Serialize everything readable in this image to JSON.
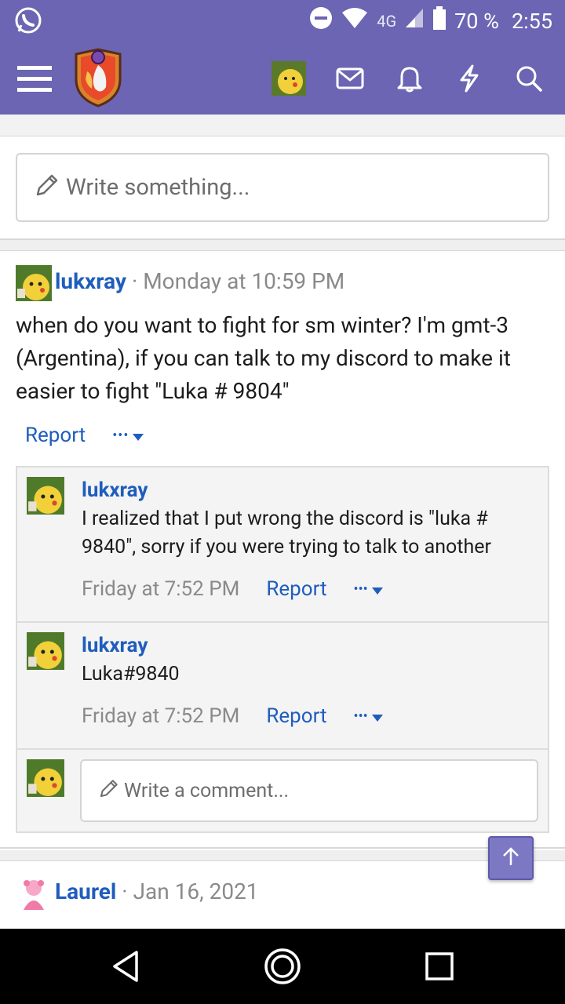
{
  "status_bar": {
    "network": "4G",
    "battery": "70 %",
    "time": "2:55"
  },
  "app_bar": {
    "icons": [
      "menu-icon",
      "site-logo",
      "user-avatar",
      "mail-icon",
      "bell-icon",
      "lightning-icon",
      "search-icon"
    ]
  },
  "composer": {
    "placeholder": "Write something..."
  },
  "post": {
    "author": "lukxray",
    "separator": "·",
    "time": "Monday at 10:59 PM",
    "body": "when do you want to fight for sm winter? I'm gmt-3 (Argentina), if you can talk to my discord to make it easier to fight \"Luka # 9804\"",
    "report_label": "Report",
    "more_label": "•••",
    "comments": [
      {
        "author": "lukxray",
        "text": "I realized that I put wrong the discord is \"luka # 9840\", sorry if you were trying to talk to another",
        "time": "Friday at 7:52 PM",
        "report_label": "Report",
        "more_label": "•••"
      },
      {
        "author": "lukxray",
        "text": "Luka#9840",
        "time": "Friday at 7:52 PM",
        "report_label": "Report",
        "more_label": "•••"
      }
    ],
    "comment_placeholder": "Write a comment..."
  },
  "post2": {
    "author": "Laurel",
    "separator": "·",
    "time": "Jan 16, 2021"
  },
  "colors": {
    "header": "#6b65b3",
    "link": "#1f5dbd",
    "muted": "#8a8a8a"
  }
}
